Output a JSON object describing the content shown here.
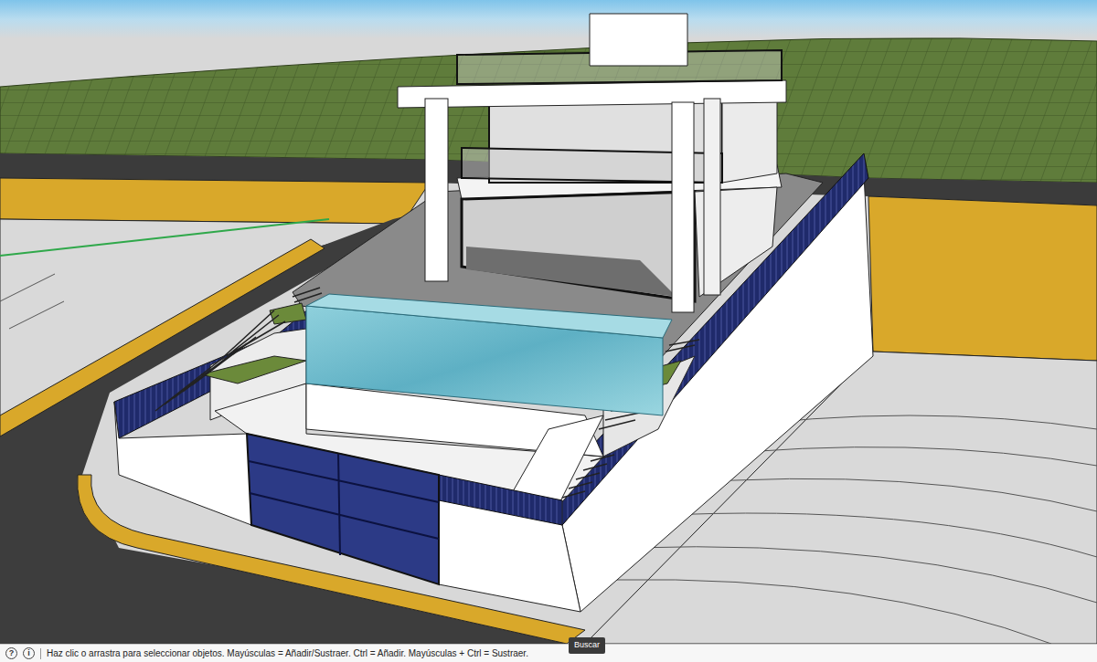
{
  "viewport": {
    "kind": "3d-model"
  },
  "status_bar": {
    "icons": [
      "?",
      "i"
    ],
    "hint": "Haz clic o arrastra para seleccionar objetos. Mayúsculas = Añadir/Sustraer. Ctrl = Añadir. Mayúsculas + Ctrl = Sustraer."
  },
  "tooltip": {
    "text": "Buscar"
  }
}
